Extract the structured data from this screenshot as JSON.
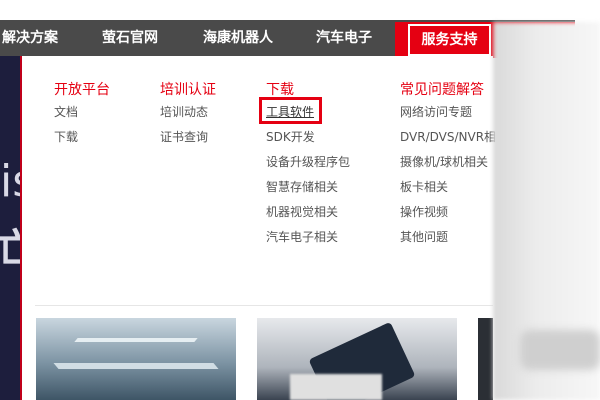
{
  "topnav": {
    "items": [
      {
        "label": "解决方案"
      },
      {
        "label": "萤石官网"
      },
      {
        "label": "海康机器人"
      },
      {
        "label": "汽车电子"
      }
    ],
    "active": {
      "label": "服务支持"
    }
  },
  "banner": {
    "letter": "is",
    "glyph": "亡"
  },
  "dropdown": {
    "columns": [
      {
        "title": "开放平台",
        "links": [
          "文档",
          "下载"
        ]
      },
      {
        "title": "培训认证",
        "links": [
          "培训动态",
          "证书查询"
        ]
      },
      {
        "title": "下载",
        "links": [
          "工具软件",
          "SDK开发",
          "设备升级程序包",
          "智慧存储相关",
          "机器视觉相关",
          "汽车电子相关"
        ]
      },
      {
        "title": "常见问题解答",
        "links": [
          "网络访问专题",
          "DVR/DVS/NVR相",
          "摄像机/球机相关",
          "板卡相关",
          "操作视频",
          "其他问题"
        ]
      }
    ]
  },
  "colors": {
    "nav_bg": "#4a4a4a",
    "accent": "#e50012",
    "link": "#555555"
  }
}
